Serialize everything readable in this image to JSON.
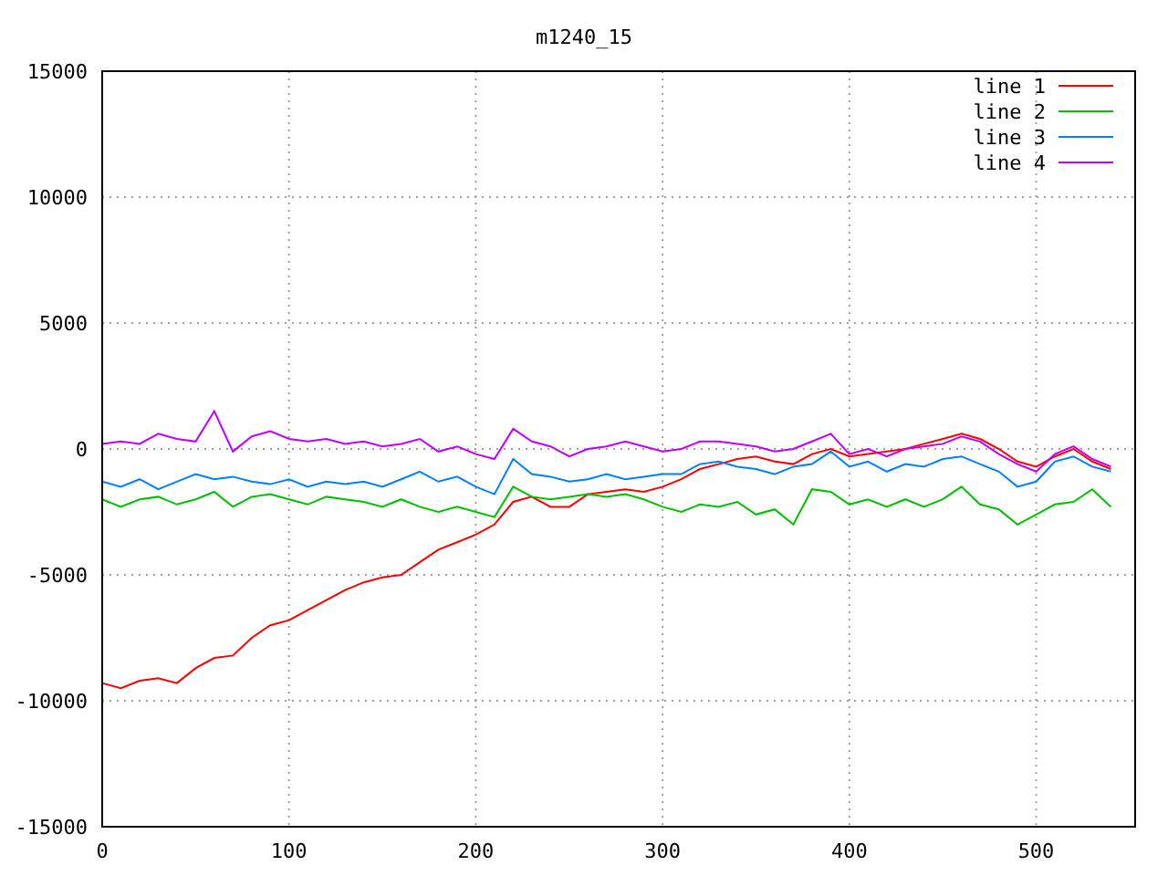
{
  "chart": {
    "chart_data": {
      "type": "line",
      "title": "m1240_15",
      "x": [
        0,
        10,
        20,
        30,
        40,
        50,
        60,
        70,
        80,
        90,
        100,
        110,
        120,
        130,
        140,
        150,
        160,
        170,
        180,
        190,
        200,
        210,
        220,
        230,
        240,
        250,
        260,
        270,
        280,
        290,
        300,
        310,
        320,
        330,
        340,
        350,
        360,
        370,
        380,
        390,
        400,
        410,
        420,
        430,
        440,
        450,
        460,
        470,
        480,
        490,
        500,
        510,
        520,
        530,
        540
      ],
      "series": [
        {
          "name": "line 1",
          "color": "#ff0000",
          "values": [
            -9300,
            -9500,
            -9200,
            -9100,
            -9300,
            -8700,
            -8300,
            -8200,
            -7500,
            -7000,
            -6800,
            -6400,
            -6000,
            -5600,
            -5300,
            -5100,
            -5000,
            -4500,
            -4000,
            -3700,
            -3400,
            -3000,
            -2100,
            -1900,
            -2300,
            -2300,
            -1800,
            -1700,
            -1600,
            -1700,
            -1500,
            -1200,
            -800,
            -600,
            -400,
            -300,
            -500,
            -600,
            -200,
            0,
            -300,
            -200,
            -100,
            0,
            200,
            400,
            600,
            400,
            0,
            -500,
            -700,
            -300,
            0,
            -500,
            -800
          ]
        },
        {
          "name": "line 2",
          "color": "#00c000",
          "values": [
            -2000,
            -2300,
            -2000,
            -1900,
            -2200,
            -2000,
            -1700,
            -2300,
            -1900,
            -1800,
            -2000,
            -2200,
            -1900,
            -2000,
            -2100,
            -2300,
            -2000,
            -2300,
            -2500,
            -2300,
            -2500,
            -2700,
            -1500,
            -1900,
            -2000,
            -1900,
            -1800,
            -1900,
            -1800,
            -2000,
            -2300,
            -2500,
            -2200,
            -2300,
            -2100,
            -2600,
            -2400,
            -3000,
            -1600,
            -1700,
            -2200,
            -2000,
            -2300,
            -2000,
            -2300,
            -2000,
            -1500,
            -2200,
            -2400,
            -3000,
            -2600,
            -2200,
            -2100,
            -1600,
            -2300
          ]
        },
        {
          "name": "line 3",
          "color": "#0080ff",
          "values": [
            -1300,
            -1500,
            -1200,
            -1600,
            -1300,
            -1000,
            -1200,
            -1100,
            -1300,
            -1400,
            -1200,
            -1500,
            -1300,
            -1400,
            -1300,
            -1500,
            -1200,
            -900,
            -1300,
            -1100,
            -1500,
            -1800,
            -400,
            -1000,
            -1100,
            -1300,
            -1200,
            -1000,
            -1200,
            -1100,
            -1000,
            -1000,
            -600,
            -500,
            -700,
            -800,
            -1000,
            -700,
            -600,
            -100,
            -700,
            -500,
            -900,
            -600,
            -700,
            -400,
            -300,
            -600,
            -900,
            -1500,
            -1300,
            -500,
            -300,
            -700,
            -900
          ]
        },
        {
          "name": "line 4",
          "color": "#c000ff",
          "values": [
            200,
            300,
            200,
            600,
            400,
            300,
            1500,
            -100,
            500,
            700,
            400,
            300,
            400,
            200,
            300,
            100,
            200,
            400,
            -100,
            100,
            -200,
            -400,
            800,
            300,
            100,
            -300,
            0,
            100,
            300,
            100,
            -100,
            0,
            300,
            300,
            200,
            100,
            -100,
            0,
            300,
            600,
            -200,
            0,
            -300,
            0,
            100,
            200,
            500,
            300,
            -200,
            -600,
            -900,
            -200,
            100,
            -400,
            -700
          ]
        }
      ],
      "grid": true,
      "legend": true,
      "xlim": [
        0,
        553
      ],
      "ylim": [
        -15000,
        15000
      ],
      "xticks": [
        0,
        100,
        200,
        300,
        400,
        500
      ],
      "yticks": [
        -15000,
        -10000,
        -5000,
        0,
        5000,
        10000,
        15000
      ]
    }
  }
}
